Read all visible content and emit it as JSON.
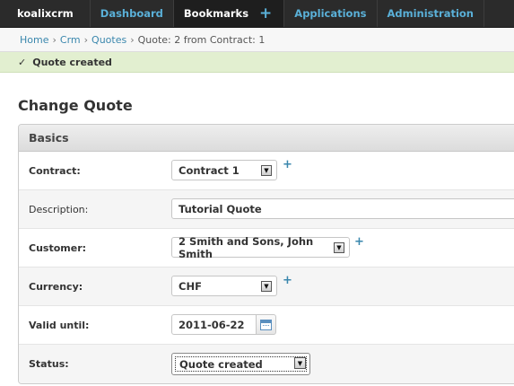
{
  "nav": {
    "brand": "koalixcrm",
    "items": [
      {
        "label": "Dashboard"
      },
      {
        "label": "Bookmarks"
      },
      {
        "label": "Applications"
      },
      {
        "label": "Administration"
      }
    ],
    "add_symbol": "+"
  },
  "breadcrumb": {
    "items": [
      "Home",
      "Crm",
      "Quotes"
    ],
    "current": "Quote: 2 from Contract: 1",
    "separator": "›"
  },
  "message": {
    "check": "✓",
    "text": "Quote created"
  },
  "page": {
    "title": "Change Quote"
  },
  "fieldset": {
    "title": "Basics",
    "fields": {
      "contract": {
        "label": "Contract:",
        "value": "Contract 1",
        "add": "+"
      },
      "description": {
        "label": "Description:",
        "value": "Tutorial Quote"
      },
      "customer": {
        "label": "Customer:",
        "value": "2 Smith and Sons, John Smith",
        "add": "+"
      },
      "currency": {
        "label": "Currency:",
        "value": "CHF",
        "add": "+"
      },
      "valid_until": {
        "label": "Valid until:",
        "value": "2011-06-22"
      },
      "status": {
        "label": "Status:",
        "value": "Quote created"
      }
    }
  },
  "icons": {
    "dropdown_arrow": "▼",
    "calendar": "calendar-icon"
  },
  "colors": {
    "nav_bg": "#2b2b2b",
    "link": "#3a87ad",
    "message_bg": "#e2efd0"
  }
}
